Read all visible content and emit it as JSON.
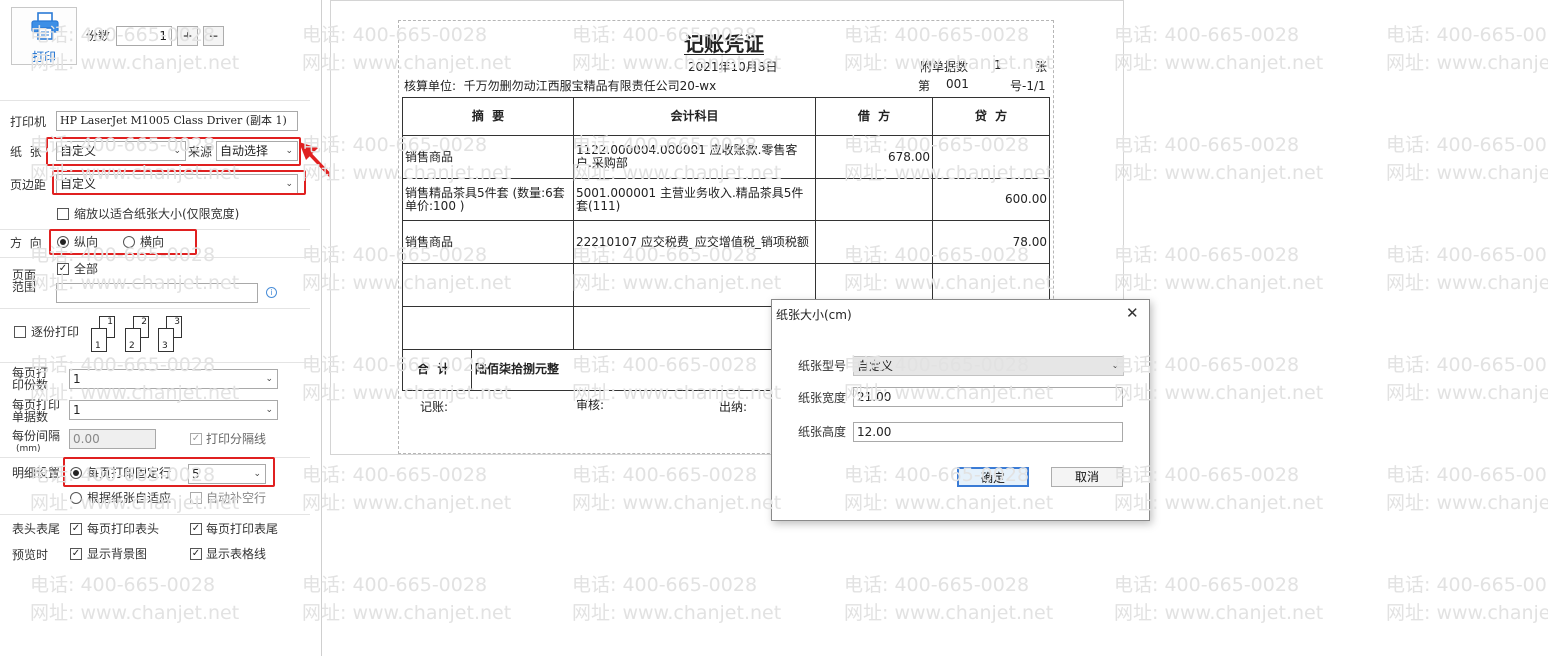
{
  "left": {
    "print_button_label": "打印",
    "copies_label": "份数",
    "copies_value": "1",
    "plus_label": "+",
    "minus_label": "−",
    "printer_label": "打印机",
    "printer_value": "HP LaserJet M1005 Class Driver (副本 1)",
    "paper_label": "纸  张",
    "paper_value": "自定义",
    "source_label": "来源",
    "source_value": "自动选择",
    "margin_label": "页边距",
    "margin_value": "自定义",
    "scale_label": "缩放以适合纸张大小(仅限宽度)",
    "direction_label": "方  向",
    "portrait_label": "纵向",
    "landscape_label": "横向",
    "page_range_label_1": "页面",
    "page_range_label_2": "范围",
    "all_label": "全部",
    "collate_label": "逐份打印",
    "collate_page_labels": [
      "1",
      "2",
      "3"
    ],
    "per_page_copies_label_1": "每页打",
    "per_page_copies_label_2": "印份数",
    "per_page_copies_value": "1",
    "per_page_vouchers_label_1": "每页打印",
    "per_page_vouchers_label_2": "单据数",
    "per_page_vouchers_value": "1",
    "gap_label_1": "每份间隔",
    "gap_label_2": "(mm)",
    "gap_value": "0.00",
    "print_separator_label": "打印分隔线",
    "detail_label": "明细设置",
    "fixed_rows_label": "每页打印固定行",
    "fixed_rows_value": "5",
    "auto_fit_label": "根据纸张自适应",
    "auto_fill_label": "自动补空行",
    "header_footer_label": "表头表尾",
    "print_header_label": "每页打印表头",
    "print_footer_label": "每页打印表尾",
    "preview_label": "预览时",
    "show_bg_label": "显示背景图",
    "show_grid_label": "显示表格线"
  },
  "voucher": {
    "title": "记账凭证",
    "date": "2021年10月8日",
    "attach_label": "附单据数",
    "attach_count": "1",
    "attach_unit": "张",
    "company": "核算单位:  千万勿删勿动江西服宝精品有限责任公司20-wx",
    "no_prefix": "第",
    "no_value": "001",
    "no_suffix": "号-1/1",
    "headers": [
      "摘  要",
      "会计科目",
      "借  方",
      "贷  方"
    ],
    "rows": [
      {
        "summary": "销售商品",
        "account": "1122.000004.000001 应收账款.零售客户.采购部",
        "debit": "678.00",
        "credit": ""
      },
      {
        "summary": "销售精品茶具5件套 (数量:6套  单价:100 )",
        "account": "5001.000001 主营业务收入.精品茶具5件套(111)",
        "debit": "",
        "credit": "600.00"
      },
      {
        "summary": "销售商品",
        "account": "22210107 应交税费_应交增值税_销项税额",
        "debit": "",
        "credit": "78.00"
      }
    ],
    "total_label": "合  计",
    "total_text": "陆佰柒拾捌元整",
    "bookkeeper_label": "记账:",
    "auditor_label": "审核:",
    "cashier_label": "出纳:"
  },
  "dialog": {
    "title": "纸张大小(cm)",
    "close_symbol": "✕",
    "type_label": "纸张型号",
    "type_value": "自定义",
    "width_label": "纸张宽度",
    "width_value": "21.00",
    "height_label": "纸张高度",
    "height_value": "12.00",
    "ok_label": "确定",
    "cancel_label": "取消"
  },
  "watermark": {
    "phone": "电话: 400-665-0028",
    "site": "网址: www.chanjet.net"
  },
  "colors": {
    "highlight": "#e02020",
    "watermark": "#e2e2e2"
  }
}
